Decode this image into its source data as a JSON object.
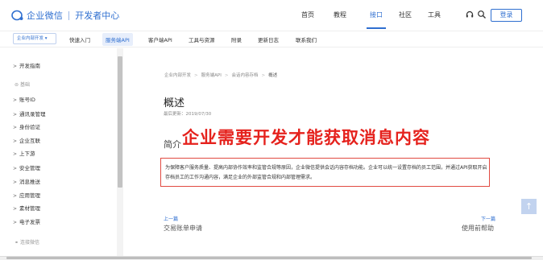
{
  "header": {
    "logo_text": "企业微信",
    "logo_sub": "开发者中心",
    "nav": [
      {
        "label": "首页"
      },
      {
        "label": "教程"
      },
      {
        "label": "接口"
      },
      {
        "label": "社区"
      },
      {
        "label": "工具"
      }
    ],
    "active_nav": "接口",
    "login_label": "登录",
    "icons": [
      "headset-icon",
      "search-icon"
    ],
    "accent_color": "#2f6fd0"
  },
  "subnav": {
    "dropdown": "企业内部开发 ▾",
    "items": [
      {
        "label": "快速入门"
      },
      {
        "label": "服务端API"
      },
      {
        "label": "客户端API"
      },
      {
        "label": "工具与资源"
      },
      {
        "label": "附录"
      },
      {
        "label": "更新日志"
      },
      {
        "label": "联系我们"
      }
    ],
    "active_item": "服务端API"
  },
  "sidebar": {
    "top_item": "开发指南",
    "section_label": "基础",
    "items": [
      {
        "label": "账号ID"
      },
      {
        "label": "通讯录管理"
      },
      {
        "label": "身份验证"
      },
      {
        "label": "企业互联"
      },
      {
        "label": "上下游"
      },
      {
        "label": "安全管理"
      },
      {
        "label": "消息推送"
      },
      {
        "label": "应用管理"
      },
      {
        "label": "素材管理"
      },
      {
        "label": "电子发票"
      }
    ],
    "bottom_label": "连接微信"
  },
  "content": {
    "breadcrumb": [
      "企业内部开发",
      "服务端API",
      "会话内容存档",
      "概述"
    ],
    "title": "概述",
    "updated": "最后更新：2019/07/30",
    "section_title": "简介",
    "annotation": "企业需要开发才能获取消息内容",
    "annotation_color": "#e5221d",
    "paragraph": "为保障客户服务质量、提高内部协作效率和监管合规等原因，企业微信提供会话内容存档功能。企业可以统一设置存档的员工范围，并通过API获取开启存档员工的工作沟通内容，满足企业的外部监管合规和内部管理需求。",
    "prev_label": "上一篇",
    "prev_title": "交易账单申请",
    "next_label": "下一篇",
    "next_title": "使用前帮助"
  },
  "back_to_top": "↑"
}
